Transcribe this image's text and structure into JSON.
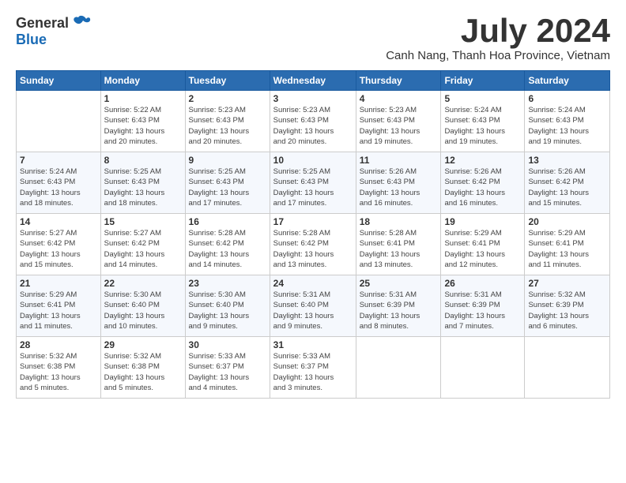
{
  "header": {
    "logo_general": "General",
    "logo_blue": "Blue",
    "month_title": "July 2024",
    "location": "Canh Nang, Thanh Hoa Province, Vietnam"
  },
  "weekdays": [
    "Sunday",
    "Monday",
    "Tuesday",
    "Wednesday",
    "Thursday",
    "Friday",
    "Saturday"
  ],
  "weeks": [
    [
      {
        "day": "",
        "info": ""
      },
      {
        "day": "1",
        "info": "Sunrise: 5:22 AM\nSunset: 6:43 PM\nDaylight: 13 hours\nand 20 minutes."
      },
      {
        "day": "2",
        "info": "Sunrise: 5:23 AM\nSunset: 6:43 PM\nDaylight: 13 hours\nand 20 minutes."
      },
      {
        "day": "3",
        "info": "Sunrise: 5:23 AM\nSunset: 6:43 PM\nDaylight: 13 hours\nand 20 minutes."
      },
      {
        "day": "4",
        "info": "Sunrise: 5:23 AM\nSunset: 6:43 PM\nDaylight: 13 hours\nand 19 minutes."
      },
      {
        "day": "5",
        "info": "Sunrise: 5:24 AM\nSunset: 6:43 PM\nDaylight: 13 hours\nand 19 minutes."
      },
      {
        "day": "6",
        "info": "Sunrise: 5:24 AM\nSunset: 6:43 PM\nDaylight: 13 hours\nand 19 minutes."
      }
    ],
    [
      {
        "day": "7",
        "info": "Sunrise: 5:24 AM\nSunset: 6:43 PM\nDaylight: 13 hours\nand 18 minutes."
      },
      {
        "day": "8",
        "info": "Sunrise: 5:25 AM\nSunset: 6:43 PM\nDaylight: 13 hours\nand 18 minutes."
      },
      {
        "day": "9",
        "info": "Sunrise: 5:25 AM\nSunset: 6:43 PM\nDaylight: 13 hours\nand 17 minutes."
      },
      {
        "day": "10",
        "info": "Sunrise: 5:25 AM\nSunset: 6:43 PM\nDaylight: 13 hours\nand 17 minutes."
      },
      {
        "day": "11",
        "info": "Sunrise: 5:26 AM\nSunset: 6:43 PM\nDaylight: 13 hours\nand 16 minutes."
      },
      {
        "day": "12",
        "info": "Sunrise: 5:26 AM\nSunset: 6:42 PM\nDaylight: 13 hours\nand 16 minutes."
      },
      {
        "day": "13",
        "info": "Sunrise: 5:26 AM\nSunset: 6:42 PM\nDaylight: 13 hours\nand 15 minutes."
      }
    ],
    [
      {
        "day": "14",
        "info": "Sunrise: 5:27 AM\nSunset: 6:42 PM\nDaylight: 13 hours\nand 15 minutes."
      },
      {
        "day": "15",
        "info": "Sunrise: 5:27 AM\nSunset: 6:42 PM\nDaylight: 13 hours\nand 14 minutes."
      },
      {
        "day": "16",
        "info": "Sunrise: 5:28 AM\nSunset: 6:42 PM\nDaylight: 13 hours\nand 14 minutes."
      },
      {
        "day": "17",
        "info": "Sunrise: 5:28 AM\nSunset: 6:42 PM\nDaylight: 13 hours\nand 13 minutes."
      },
      {
        "day": "18",
        "info": "Sunrise: 5:28 AM\nSunset: 6:41 PM\nDaylight: 13 hours\nand 13 minutes."
      },
      {
        "day": "19",
        "info": "Sunrise: 5:29 AM\nSunset: 6:41 PM\nDaylight: 13 hours\nand 12 minutes."
      },
      {
        "day": "20",
        "info": "Sunrise: 5:29 AM\nSunset: 6:41 PM\nDaylight: 13 hours\nand 11 minutes."
      }
    ],
    [
      {
        "day": "21",
        "info": "Sunrise: 5:29 AM\nSunset: 6:41 PM\nDaylight: 13 hours\nand 11 minutes."
      },
      {
        "day": "22",
        "info": "Sunrise: 5:30 AM\nSunset: 6:40 PM\nDaylight: 13 hours\nand 10 minutes."
      },
      {
        "day": "23",
        "info": "Sunrise: 5:30 AM\nSunset: 6:40 PM\nDaylight: 13 hours\nand 9 minutes."
      },
      {
        "day": "24",
        "info": "Sunrise: 5:31 AM\nSunset: 6:40 PM\nDaylight: 13 hours\nand 9 minutes."
      },
      {
        "day": "25",
        "info": "Sunrise: 5:31 AM\nSunset: 6:39 PM\nDaylight: 13 hours\nand 8 minutes."
      },
      {
        "day": "26",
        "info": "Sunrise: 5:31 AM\nSunset: 6:39 PM\nDaylight: 13 hours\nand 7 minutes."
      },
      {
        "day": "27",
        "info": "Sunrise: 5:32 AM\nSunset: 6:39 PM\nDaylight: 13 hours\nand 6 minutes."
      }
    ],
    [
      {
        "day": "28",
        "info": "Sunrise: 5:32 AM\nSunset: 6:38 PM\nDaylight: 13 hours\nand 5 minutes."
      },
      {
        "day": "29",
        "info": "Sunrise: 5:32 AM\nSunset: 6:38 PM\nDaylight: 13 hours\nand 5 minutes."
      },
      {
        "day": "30",
        "info": "Sunrise: 5:33 AM\nSunset: 6:37 PM\nDaylight: 13 hours\nand 4 minutes."
      },
      {
        "day": "31",
        "info": "Sunrise: 5:33 AM\nSunset: 6:37 PM\nDaylight: 13 hours\nand 3 minutes."
      },
      {
        "day": "",
        "info": ""
      },
      {
        "day": "",
        "info": ""
      },
      {
        "day": "",
        "info": ""
      }
    ]
  ]
}
